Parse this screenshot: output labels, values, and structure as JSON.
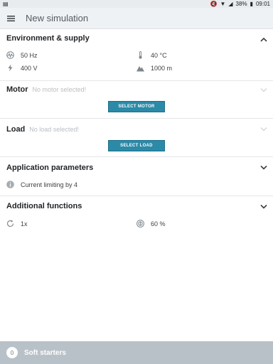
{
  "statusbar": {
    "battery": "38%",
    "time": "09:01"
  },
  "appbar": {
    "title": "New simulation"
  },
  "environment": {
    "title": "Environment & supply",
    "frequency": "50 Hz",
    "voltage": "400 V",
    "temperature": "40 °C",
    "altitude": "1000 m"
  },
  "motor": {
    "title": "Motor",
    "hint": "No motor selected!",
    "button": "SELECT MOTOR"
  },
  "load": {
    "title": "Load",
    "hint": "No load selected!",
    "button": "SELECT LOAD"
  },
  "application": {
    "title": "Application parameters",
    "current_limiting": "Current limiting by 4"
  },
  "additional": {
    "title": "Additional functions",
    "starts": "1x",
    "percentage": "60 %"
  },
  "footer": {
    "count": "0",
    "title": "Soft starters"
  },
  "colors": {
    "accent": "#2b8aa8",
    "footer": "#b9c1c8"
  }
}
